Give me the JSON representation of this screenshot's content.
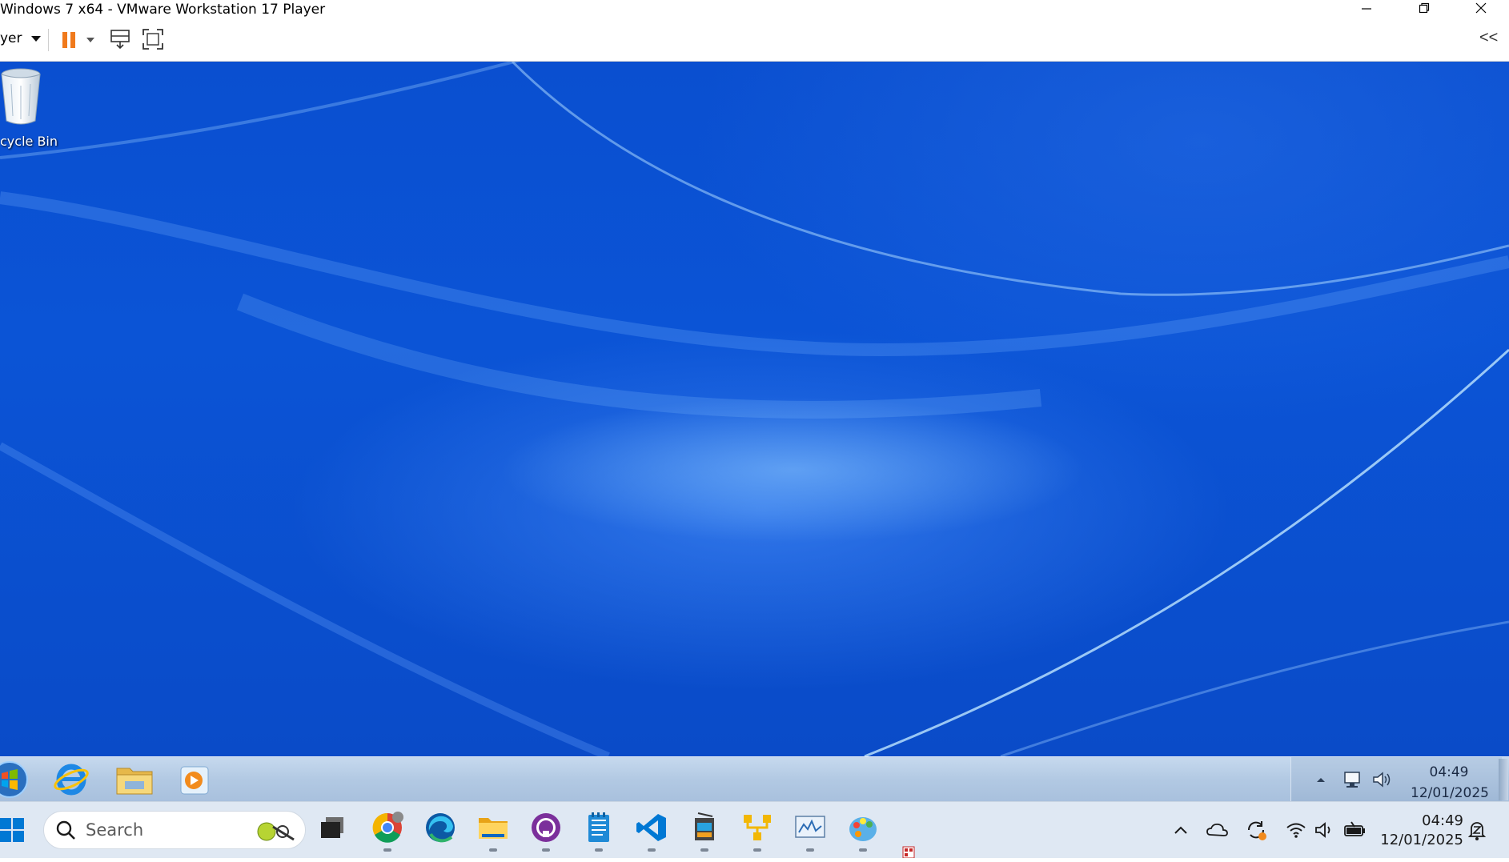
{
  "window": {
    "title": "Windows 7 x64 - VMware Workstation 17 Player",
    "minimize_icon": "minimize-icon",
    "restore_icon": "restore-icon",
    "close_icon": "close-icon"
  },
  "toolbar": {
    "player_menu_label": "yer",
    "icons": [
      "pause-icon",
      "dropdown-arrow-icon",
      "send-ctrl-alt-del-icon",
      "fullscreen-icon",
      "collapse-toolbar-icon"
    ],
    "collapse_label": "<<"
  },
  "desktop": {
    "recycle_bin_label": "cycle Bin"
  },
  "win7_taskbar": {
    "pinned": [
      "start-orb-icon",
      "internet-explorer-icon",
      "windows-explorer-icon",
      "media-player-icon"
    ],
    "tray_icons": [
      "show-hidden-icons-arrow",
      "network-icon",
      "volume-icon"
    ],
    "time": "04:49",
    "date": "12/01/2025"
  },
  "host_taskbar": {
    "search_placeholder": "Search",
    "apps": [
      "task-view-icon",
      "chrome-icon",
      "edge-icon",
      "file-explorer-icon",
      "github-desktop-icon",
      "notepad-icon",
      "vscode-icon",
      "app-icon",
      "yellow-app-icon",
      "monitor-app-icon",
      "paint-app-icon"
    ],
    "tray_icons": [
      "chevron-up-icon",
      "onedrive-icon",
      "sync-icon",
      "wifi-icon",
      "speaker-icon",
      "battery-icon",
      "notification-icon"
    ],
    "time": "04:49",
    "date": "12/01/2025"
  },
  "colors": {
    "desktop_blue": "#0a4fd0",
    "pause_orange": "#f07a1c",
    "host_taskbar": "#dfe8f3"
  }
}
